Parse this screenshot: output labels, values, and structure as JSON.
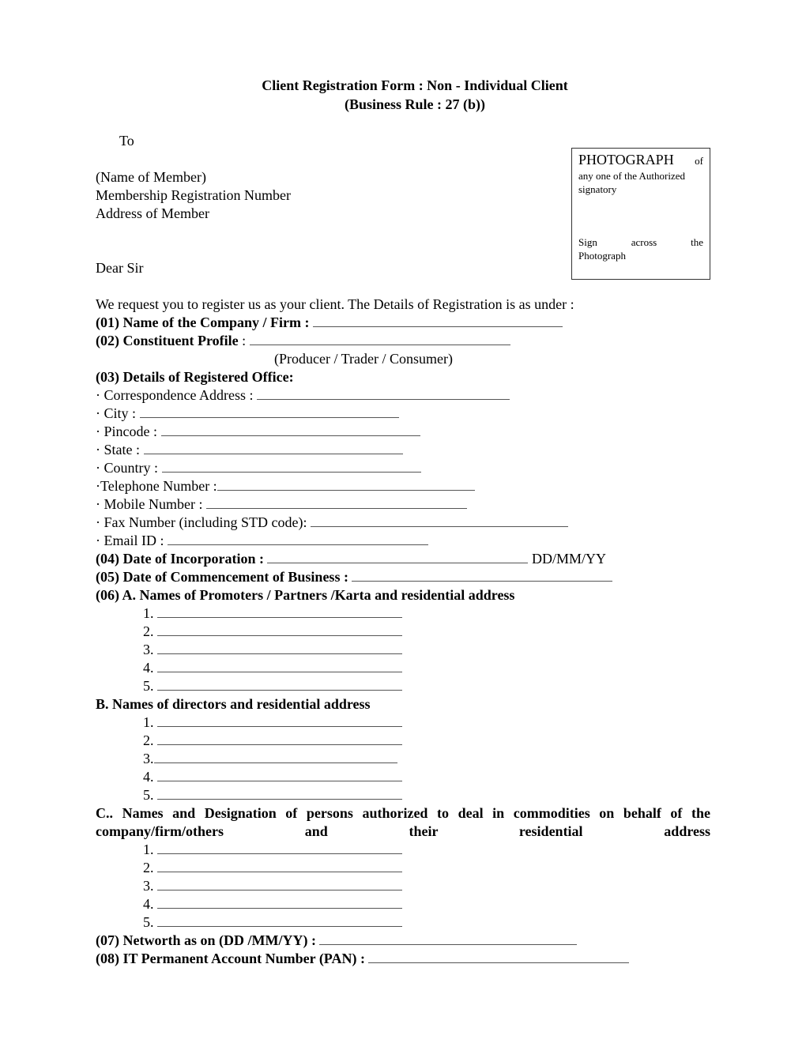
{
  "header": {
    "title": "Client Registration Form : Non - Individual Client",
    "subtitle": "(Business Rule : 27 (b))"
  },
  "addressee": {
    "to": "To",
    "name": "(Name of Member)",
    "reg_no": "Membership Registration Number",
    "address": "Address of Member",
    "salutation": "Dear Sir"
  },
  "photo_box": {
    "heading": "PHOTOGRAPH",
    "heading_suffix": "of",
    "text": "any one of the Authorized signatory",
    "sign_words": [
      "Sign",
      "across",
      "the"
    ],
    "sign_last": "Photograph"
  },
  "intro": "We request you to register us as your client. The Details of Registration is as under :",
  "fields": {
    "f01": "(01) Name of the Company / Firm :",
    "f02_bold": "(02) Constituent Profile",
    "f02_colon": " :",
    "f02_hint": "(Producer / Trader / Consumer)",
    "f03": "(03) Details of Registered Office:",
    "office": [
      "· Correspondence Address :",
      "· City :",
      "· Pincode :",
      "· State :",
      "· Country :",
      "·Telephone Number :",
      "· Mobile Number :",
      "· Fax Number (including STD code):",
      "· Email ID :"
    ],
    "f04": "(04) Date of Incorporation :",
    "f04_suffix": "DD/MM/YY",
    "f05": "(05) Date of Commencement of Business :",
    "f06a": "(06) A. Names of Promoters / Partners /Karta and residential address",
    "f06b": "B. Names of directors and residential address",
    "f06c": "C.. Names and Designation of persons authorized to deal in commodities on behalf of the company/firm/others and their residential address",
    "f07": "(07) Networth as on (DD /MM/YY) :",
    "f08": "(08) IT Permanent Account Number (PAN) :"
  },
  "numbers": [
    "1.",
    "2.",
    "3.",
    "4.",
    "5."
  ]
}
